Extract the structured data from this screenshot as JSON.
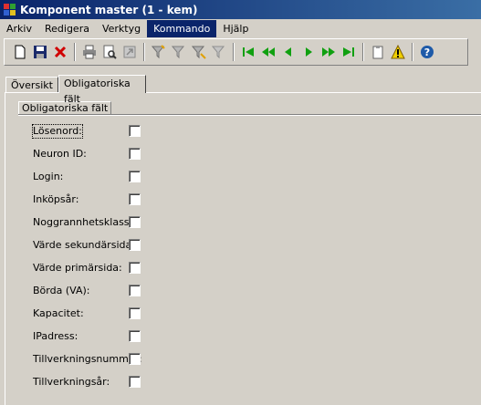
{
  "window": {
    "title": "Komponent master (1 - kem)"
  },
  "menu": [
    "Arkiv",
    "Redigera",
    "Verktyg",
    "Kommando",
    "Hjälp"
  ],
  "tabs": [
    "Översikt",
    "Obligatoriska fält"
  ],
  "group": {
    "label": "Obligatoriska fält"
  },
  "fields": [
    {
      "label": "Lösenord:",
      "checked": false
    },
    {
      "label": "Neuron ID:",
      "checked": false
    },
    {
      "label": "Login:",
      "checked": false
    },
    {
      "label": "Inköpsår:",
      "checked": false
    },
    {
      "label": "Noggrannhetsklass:",
      "checked": false
    },
    {
      "label": "Värde sekundärsida:",
      "checked": false
    },
    {
      "label": "Värde primärsida:",
      "checked": false
    },
    {
      "label": "Börda (VA):",
      "checked": false
    },
    {
      "label": "Kapacitet:",
      "checked": false
    },
    {
      "label": "IPadress:",
      "checked": false
    },
    {
      "label": "Tillverkningsnummer:",
      "checked": false
    },
    {
      "label": "Tillverkningsår:",
      "checked": false
    }
  ],
  "toolbar_icons": [
    "new-icon",
    "save-icon",
    "delete-icon",
    "print-icon",
    "print-preview-icon",
    "export-icon",
    "filter-icon",
    "filter-remove-icon",
    "filter-advanced-icon",
    "filter-clear-icon",
    "first-record-icon",
    "previous-page-icon",
    "previous-record-icon",
    "next-record-icon",
    "next-page-icon",
    "last-record-icon",
    "clipboard-icon",
    "alert-icon",
    "help-icon"
  ]
}
